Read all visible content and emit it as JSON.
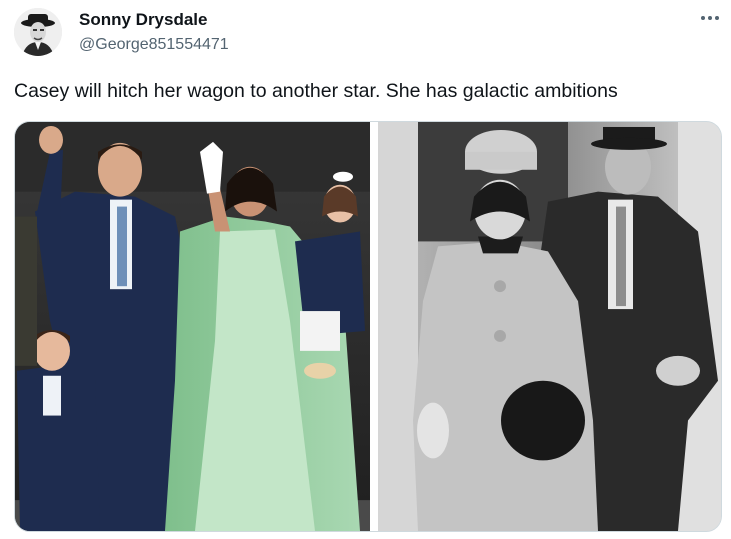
{
  "author": {
    "display_name": "Sonny Drysdale",
    "handle": "@George851554471",
    "avatar_icon": "bw-portrait-avatar"
  },
  "menu": {
    "icon": "more-horizontal-icon"
  },
  "tweet": {
    "text": "Casey will hitch her wagon to another star. She has galactic ambitions"
  },
  "media": {
    "photos": [
      {
        "name": "color-photo",
        "style": "color"
      },
      {
        "name": "bw-photo",
        "style": "black-and-white"
      }
    ]
  },
  "colors": {
    "text_primary": "#0f1419",
    "text_secondary": "#536471",
    "border": "#cfd9de",
    "dress_mint": "#b9dfc0",
    "suit_navy": "#1e2c4f"
  }
}
